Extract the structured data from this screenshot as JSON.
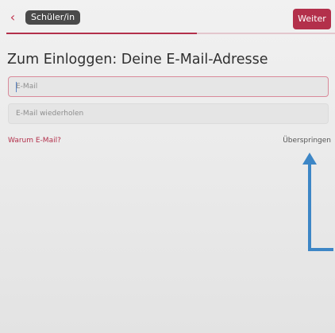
{
  "header": {
    "back_icon": "chevron-left-icon",
    "back_glyph": "‹",
    "role_label": "Schüler/in",
    "next_label": "Weiter",
    "progress": 0.58,
    "accent_color": "#b3304b"
  },
  "main": {
    "title": "Zum Einloggen: Deine E-Mail-Adresse",
    "email_placeholder": "E-Mail",
    "email_repeat_placeholder": "E-Mail wiederholen",
    "why_email_label": "Warum E-Mail?",
    "skip_label": "Überspringen"
  },
  "annotation": {
    "arrow_color": "#3d86c6",
    "arrow_icon": "arrow-up-icon"
  }
}
